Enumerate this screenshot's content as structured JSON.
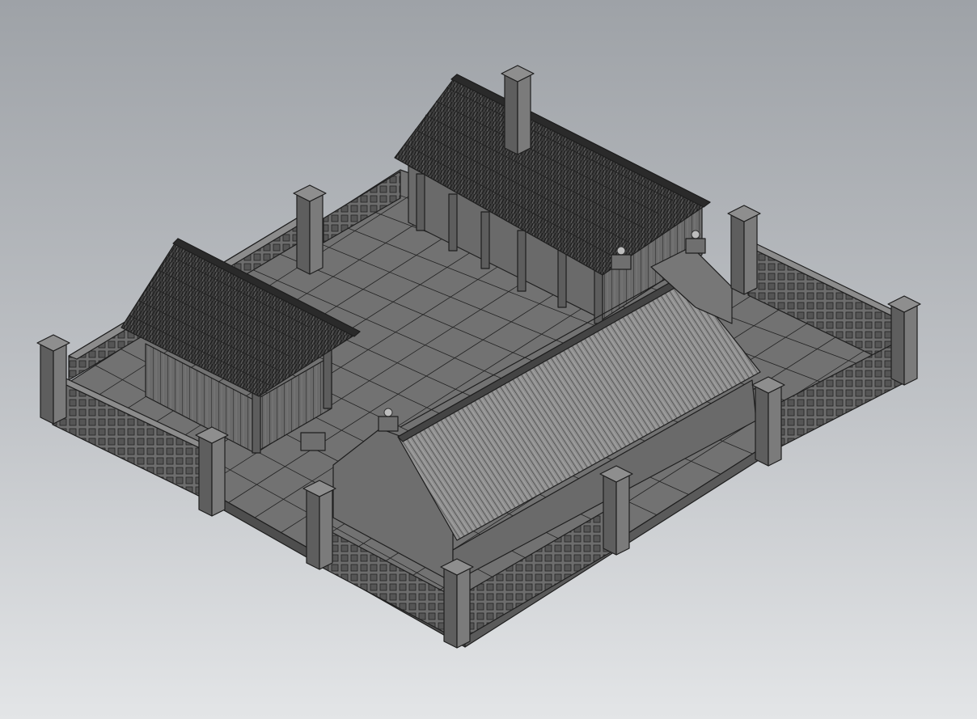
{
  "viewport": {
    "background_top": "#9ea2a7",
    "background_bottom": "#e3e5e7"
  },
  "model": {
    "render_style": "shaded-with-edges",
    "view": "isometric",
    "stone_color": "#7b7b7b",
    "stone_dark": "#5e5e5e",
    "stone_light": "#8e8e8e",
    "roof_color": "#3a3a3a",
    "floor_color": "#6f6f6f",
    "parts": [
      {
        "id": "courtyard-floor",
        "kind": "tiled-floor"
      },
      {
        "id": "main-hall",
        "kind": "thatched-hall"
      },
      {
        "id": "small-shed",
        "kind": "thatched-shed"
      },
      {
        "id": "gatehouse",
        "kind": "tiled-roof-gate"
      },
      {
        "id": "perimeter-wall",
        "kind": "lattice-wall"
      },
      {
        "id": "corner-pillars",
        "kind": "pillars"
      }
    ]
  }
}
